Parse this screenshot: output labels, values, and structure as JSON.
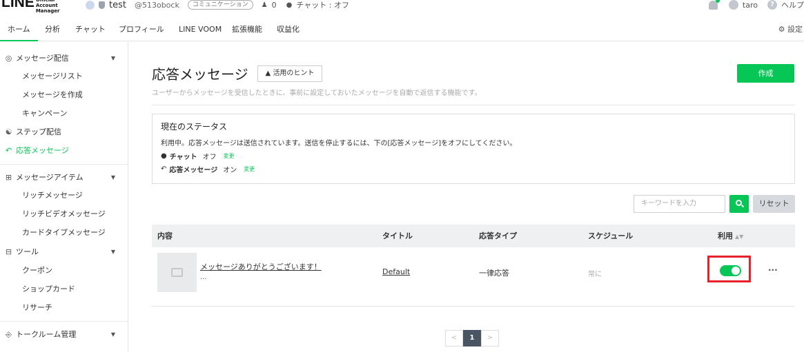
{
  "header": {
    "logo_text": "LINE",
    "logo_sub": "Official Account Manager",
    "account_name": "test",
    "account_id": "@513obock",
    "account_type_pill": "コミュニケーション",
    "friends_count": "0",
    "chat_status": "チャット : オフ",
    "user_name": "taro",
    "help_label": "ヘルプ"
  },
  "tabs": [
    {
      "label": "ホーム",
      "active": true
    },
    {
      "label": "分析"
    },
    {
      "label": "チャット"
    },
    {
      "label": "プロフィール"
    },
    {
      "label": "LINE VOOM"
    },
    {
      "label": "拡張機能"
    },
    {
      "label": "収益化"
    }
  ],
  "settings_label": "設定",
  "sidebar": {
    "messaging_group": "メッセージ配信",
    "message_list": "メッセージリスト",
    "create_message": "メッセージを作成",
    "campaign": "キャンペーン",
    "step_delivery": "ステップ配信",
    "auto_response": "応答メッセージ",
    "items_group": "メッセージアイテム",
    "rich_message": "リッチメッセージ",
    "rich_video": "リッチビデオメッセージ",
    "card_type": "カードタイプメッセージ",
    "tools_group": "ツール",
    "coupon": "クーポン",
    "shop_card": "ショップカード",
    "research": "リサーチ",
    "talkroom_group": "トークルーム管理"
  },
  "main": {
    "title": "応答メッセージ",
    "hint_button": "活用のヒント",
    "create_button": "作成",
    "description": "ユーザーからメッセージを受信したときに、事前に設定しておいたメッセージを自動で返信する機能です。",
    "status": {
      "title": "現在のステータス",
      "description": "利用中。応答メッセージは送信されています。送信を停止するには、下の[応答メッセージ]をオフにしてください。",
      "chat_label": "チャット",
      "chat_value": "オフ",
      "response_label": "応答メッセージ",
      "response_value": "オン",
      "change_link": "変更"
    },
    "search": {
      "placeholder": "キーワードを入力",
      "reset_label": "リセット"
    },
    "table": {
      "headers": {
        "content": "内容",
        "title": "タイトル",
        "response_type": "応答タイプ",
        "schedule": "スケジュール",
        "use": "利用"
      },
      "rows": [
        {
          "message": "メッセージありがとうございます！",
          "message_more": "...",
          "title": "Default",
          "response_type": "一律応答",
          "schedule": "常に",
          "enabled": true,
          "more": "···"
        }
      ]
    },
    "pagination": {
      "prev": "<",
      "current": "1",
      "next": ">"
    }
  },
  "colors": {
    "accent": "#06c755",
    "highlight_frame": "#e8202a",
    "pager_active": "#4a5563"
  }
}
